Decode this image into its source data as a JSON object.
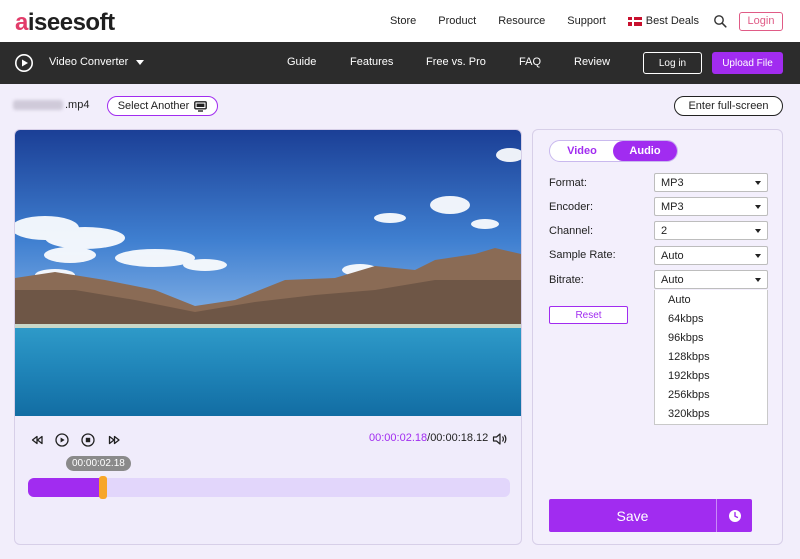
{
  "brand": {
    "logo_prefix": "a",
    "logo_rest": "iseesoft",
    "accent": "#a12cf0",
    "logo_accent": "#e23c6a"
  },
  "top_nav": {
    "items": [
      "Store",
      "Product",
      "Resource",
      "Support"
    ],
    "deals": "Best Deals",
    "login": "Login"
  },
  "dark_nav": {
    "app_name": "Video Converter",
    "items": [
      "Guide",
      "Features",
      "Free vs. Pro",
      "FAQ",
      "Review"
    ],
    "login": "Log in",
    "upload": "Upload File"
  },
  "file": {
    "extension": ".mp4",
    "select_another": "Select Another",
    "fullscreen": "Enter full-screen"
  },
  "player": {
    "current_time": "00:00:02.18",
    "separator": "/",
    "total_time": "00:00:18.12",
    "tooltip": "00:00:02.18",
    "progress_fraction": 0.155
  },
  "settings": {
    "tabs": {
      "video": "Video",
      "audio": "Audio",
      "active": "Audio"
    },
    "rows": [
      {
        "label": "Format:",
        "value": "MP3"
      },
      {
        "label": "Encoder:",
        "value": "MP3"
      },
      {
        "label": "Channel:",
        "value": "2"
      },
      {
        "label": "Sample Rate:",
        "value": "Auto"
      },
      {
        "label": "Bitrate:",
        "value": "Auto"
      }
    ],
    "reset": "Reset",
    "bitrate_options": [
      "Auto",
      "64kbps",
      "96kbps",
      "128kbps",
      "192kbps",
      "256kbps",
      "320kbps"
    ],
    "save": "Save"
  }
}
